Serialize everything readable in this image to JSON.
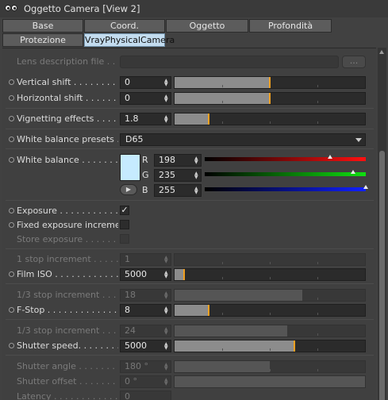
{
  "window": {
    "title": "Oggetto Camera [View 2]"
  },
  "tabs": {
    "row1": [
      {
        "label": "Base",
        "active": false
      },
      {
        "label": "Coord.",
        "active": false
      },
      {
        "label": "Oggetto",
        "active": false
      },
      {
        "label": "Profondità",
        "active": false
      }
    ],
    "row2": [
      {
        "label": "Protezione",
        "active": false
      },
      {
        "label": "VrayPhysicalCamera",
        "active": true
      }
    ]
  },
  "params": {
    "lens_description": {
      "label": "Lens description file . . . . .",
      "button": "..."
    },
    "vertical_shift": {
      "label": "Vertical shift . . . . . . . . . .",
      "value": "0",
      "slider_fraction": 0.5
    },
    "horizontal_shift": {
      "label": "Horizontal shift . . . . . . . .",
      "value": "0",
      "slider_fraction": 0.5
    },
    "vignetting": {
      "label": "Vignetting effects . . . . . .",
      "value": "1.8",
      "slider_fraction": 0.18
    },
    "white_balance_presets": {
      "label": "White balance presets . . .",
      "value": "D65"
    },
    "white_balance": {
      "label": "White balance . . . . . . .",
      "color": "#c6ebff",
      "r_label": "R",
      "r_value": "198",
      "r_fraction": 0.776,
      "g_label": "G",
      "g_value": "235",
      "g_fraction": 0.922,
      "b_label": "B",
      "b_value": "255",
      "b_fraction": 1.0
    },
    "exposure": {
      "label": "Exposure . . . . . . . . . . . . .",
      "checked": "✓"
    },
    "fixed_exposure": {
      "label": "Fixed exposure increments",
      "checked": ""
    },
    "store_exposure": {
      "label": "Store exposure . . . . . . . .",
      "checked": ""
    },
    "iso_increment": {
      "label": "1 stop increment . . . . . . .",
      "value": "1",
      "slider_fraction": 0.0
    },
    "film_iso": {
      "label": "Film ISO . . . . . . . . . . . . .",
      "value": "5000",
      "slider_fraction": 0.05
    },
    "fstop_increment": {
      "label": "1/3 stop increment . . . . . .",
      "value": "18",
      "slider_fraction": 0.67
    },
    "fstop": {
      "label": "F-Stop . . . . . . . . . . . . . . .",
      "value": "8",
      "slider_fraction": 0.18
    },
    "shutter_increment": {
      "label": "1/3 stop increment . . . . . .",
      "value": "24",
      "slider_fraction": 0.59
    },
    "shutter_speed": {
      "label": "Shutter speed. . . . . . . . . .",
      "value": "5000",
      "slider_fraction": 0.63
    },
    "shutter_angle": {
      "label": "Shutter angle . . . . . . . . .",
      "value": "180 °",
      "slider_fraction": 0.5
    },
    "shutter_offset": {
      "label": "Shutter offset . . . . . . . . .",
      "value": "0 °",
      "slider_fraction": 1.0
    },
    "latency": {
      "label": "Latency . . . . . . . . . . . . . .",
      "value": "0"
    }
  }
}
